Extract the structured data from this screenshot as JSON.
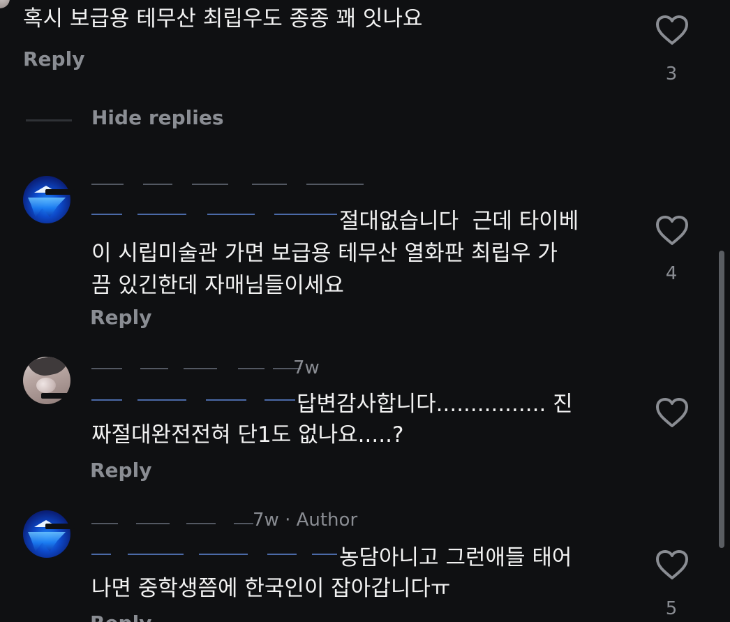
{
  "comments": [
    {
      "text_lines": [
        "혹시 보급용 테무산 최립우도 종종 꽤 잇나요"
      ],
      "reply_label": "Reply",
      "likes": "3"
    },
    {
      "hide_replies_label": "Hide replies"
    },
    {
      "mention": "@",
      "text_lines": [
        "절대없습니다  근데 타이베",
        "이 시립미술관 가면 보급용 테무산 열화판 최립우 가",
        "끔 있긴한데 자매님들이세요"
      ],
      "reply_label": "Reply",
      "likes": "4"
    },
    {
      "meta_time": "7w",
      "mention": "@",
      "text_lines": [
        "답변감사합니다................ 진",
        "짜절대완전전혀 단1도 없나요.....?"
      ],
      "reply_label": "Reply"
    },
    {
      "meta_time": "7w · Author",
      "mention": "@",
      "text_lines": [
        "농담아니고 그런애들 태어",
        "나면 중학생쯤에 한국인이 잡아갑니다ㅠ"
      ],
      "reply_label": "Reply",
      "likes": "5"
    }
  ],
  "icons": {
    "like": "heart-outline-icon"
  },
  "colors": {
    "background": "#0f1012",
    "text": "#f2f2f2",
    "muted": "#8a8d93",
    "mention": "#4b6aa8"
  }
}
